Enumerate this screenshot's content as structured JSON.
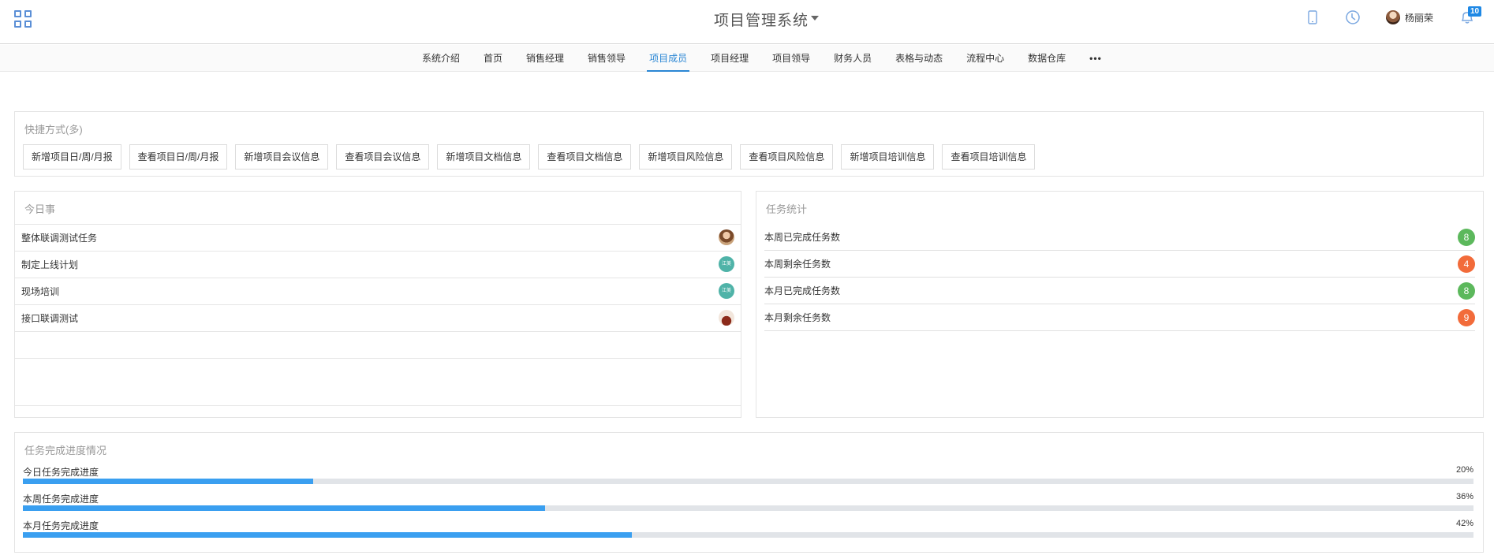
{
  "header": {
    "title": "项目管理系统",
    "user_name": "杨丽荣",
    "notification_count": "10",
    "icons": [
      "apps-grid-icon",
      "mobile-icon",
      "clock-icon",
      "bell-icon"
    ]
  },
  "nav": {
    "items": [
      {
        "label": "系统介绍"
      },
      {
        "label": "首页"
      },
      {
        "label": "销售经理"
      },
      {
        "label": "销售领导"
      },
      {
        "label": "项目成员",
        "active": true
      },
      {
        "label": "项目经理"
      },
      {
        "label": "项目领导"
      },
      {
        "label": "财务人员"
      },
      {
        "label": "表格与动态"
      },
      {
        "label": "流程中心"
      },
      {
        "label": "数据仓库"
      }
    ],
    "more": "•••"
  },
  "quick": {
    "title": "快捷方式(多)",
    "buttons": [
      "新增项目日/周/月报",
      "查看项目日/周/月报",
      "新增项目会议信息",
      "查看项目会议信息",
      "新增项目文档信息",
      "查看项目文档信息",
      "新增项目风险信息",
      "查看项目风险信息",
      "新增项目培训信息",
      "查看项目培训信息"
    ]
  },
  "today": {
    "title": "今日事",
    "items": [
      {
        "label": "整体联调测试任务",
        "avatar": "photo"
      },
      {
        "label": "制定上线计划",
        "avatar": "teal",
        "avatar_text": "江美"
      },
      {
        "label": "现场培训",
        "avatar": "teal",
        "avatar_text": "江美"
      },
      {
        "label": "接口联调测试",
        "avatar": "person"
      }
    ]
  },
  "stats": {
    "title": "任务统计",
    "items": [
      {
        "label": "本周已完成任务数",
        "value": "8",
        "color": "#5cb85c"
      },
      {
        "label": "本周剩余任务数",
        "value": "4",
        "color": "#f26b3a"
      },
      {
        "label": "本月已完成任务数",
        "value": "8",
        "color": "#5cb85c"
      },
      {
        "label": "本月剩余任务数",
        "value": "9",
        "color": "#f26b3a"
      }
    ]
  },
  "progress": {
    "title": "任务完成进度情况",
    "items": [
      {
        "label": "今日任务完成进度",
        "percent_text": "20%",
        "percent": 20
      },
      {
        "label": "本周任务完成进度",
        "percent_text": "36%",
        "percent": 36
      },
      {
        "label": "本月任务完成进度",
        "percent_text": "42%",
        "percent": 42
      }
    ],
    "bar_color": "#3a9ff0"
  }
}
